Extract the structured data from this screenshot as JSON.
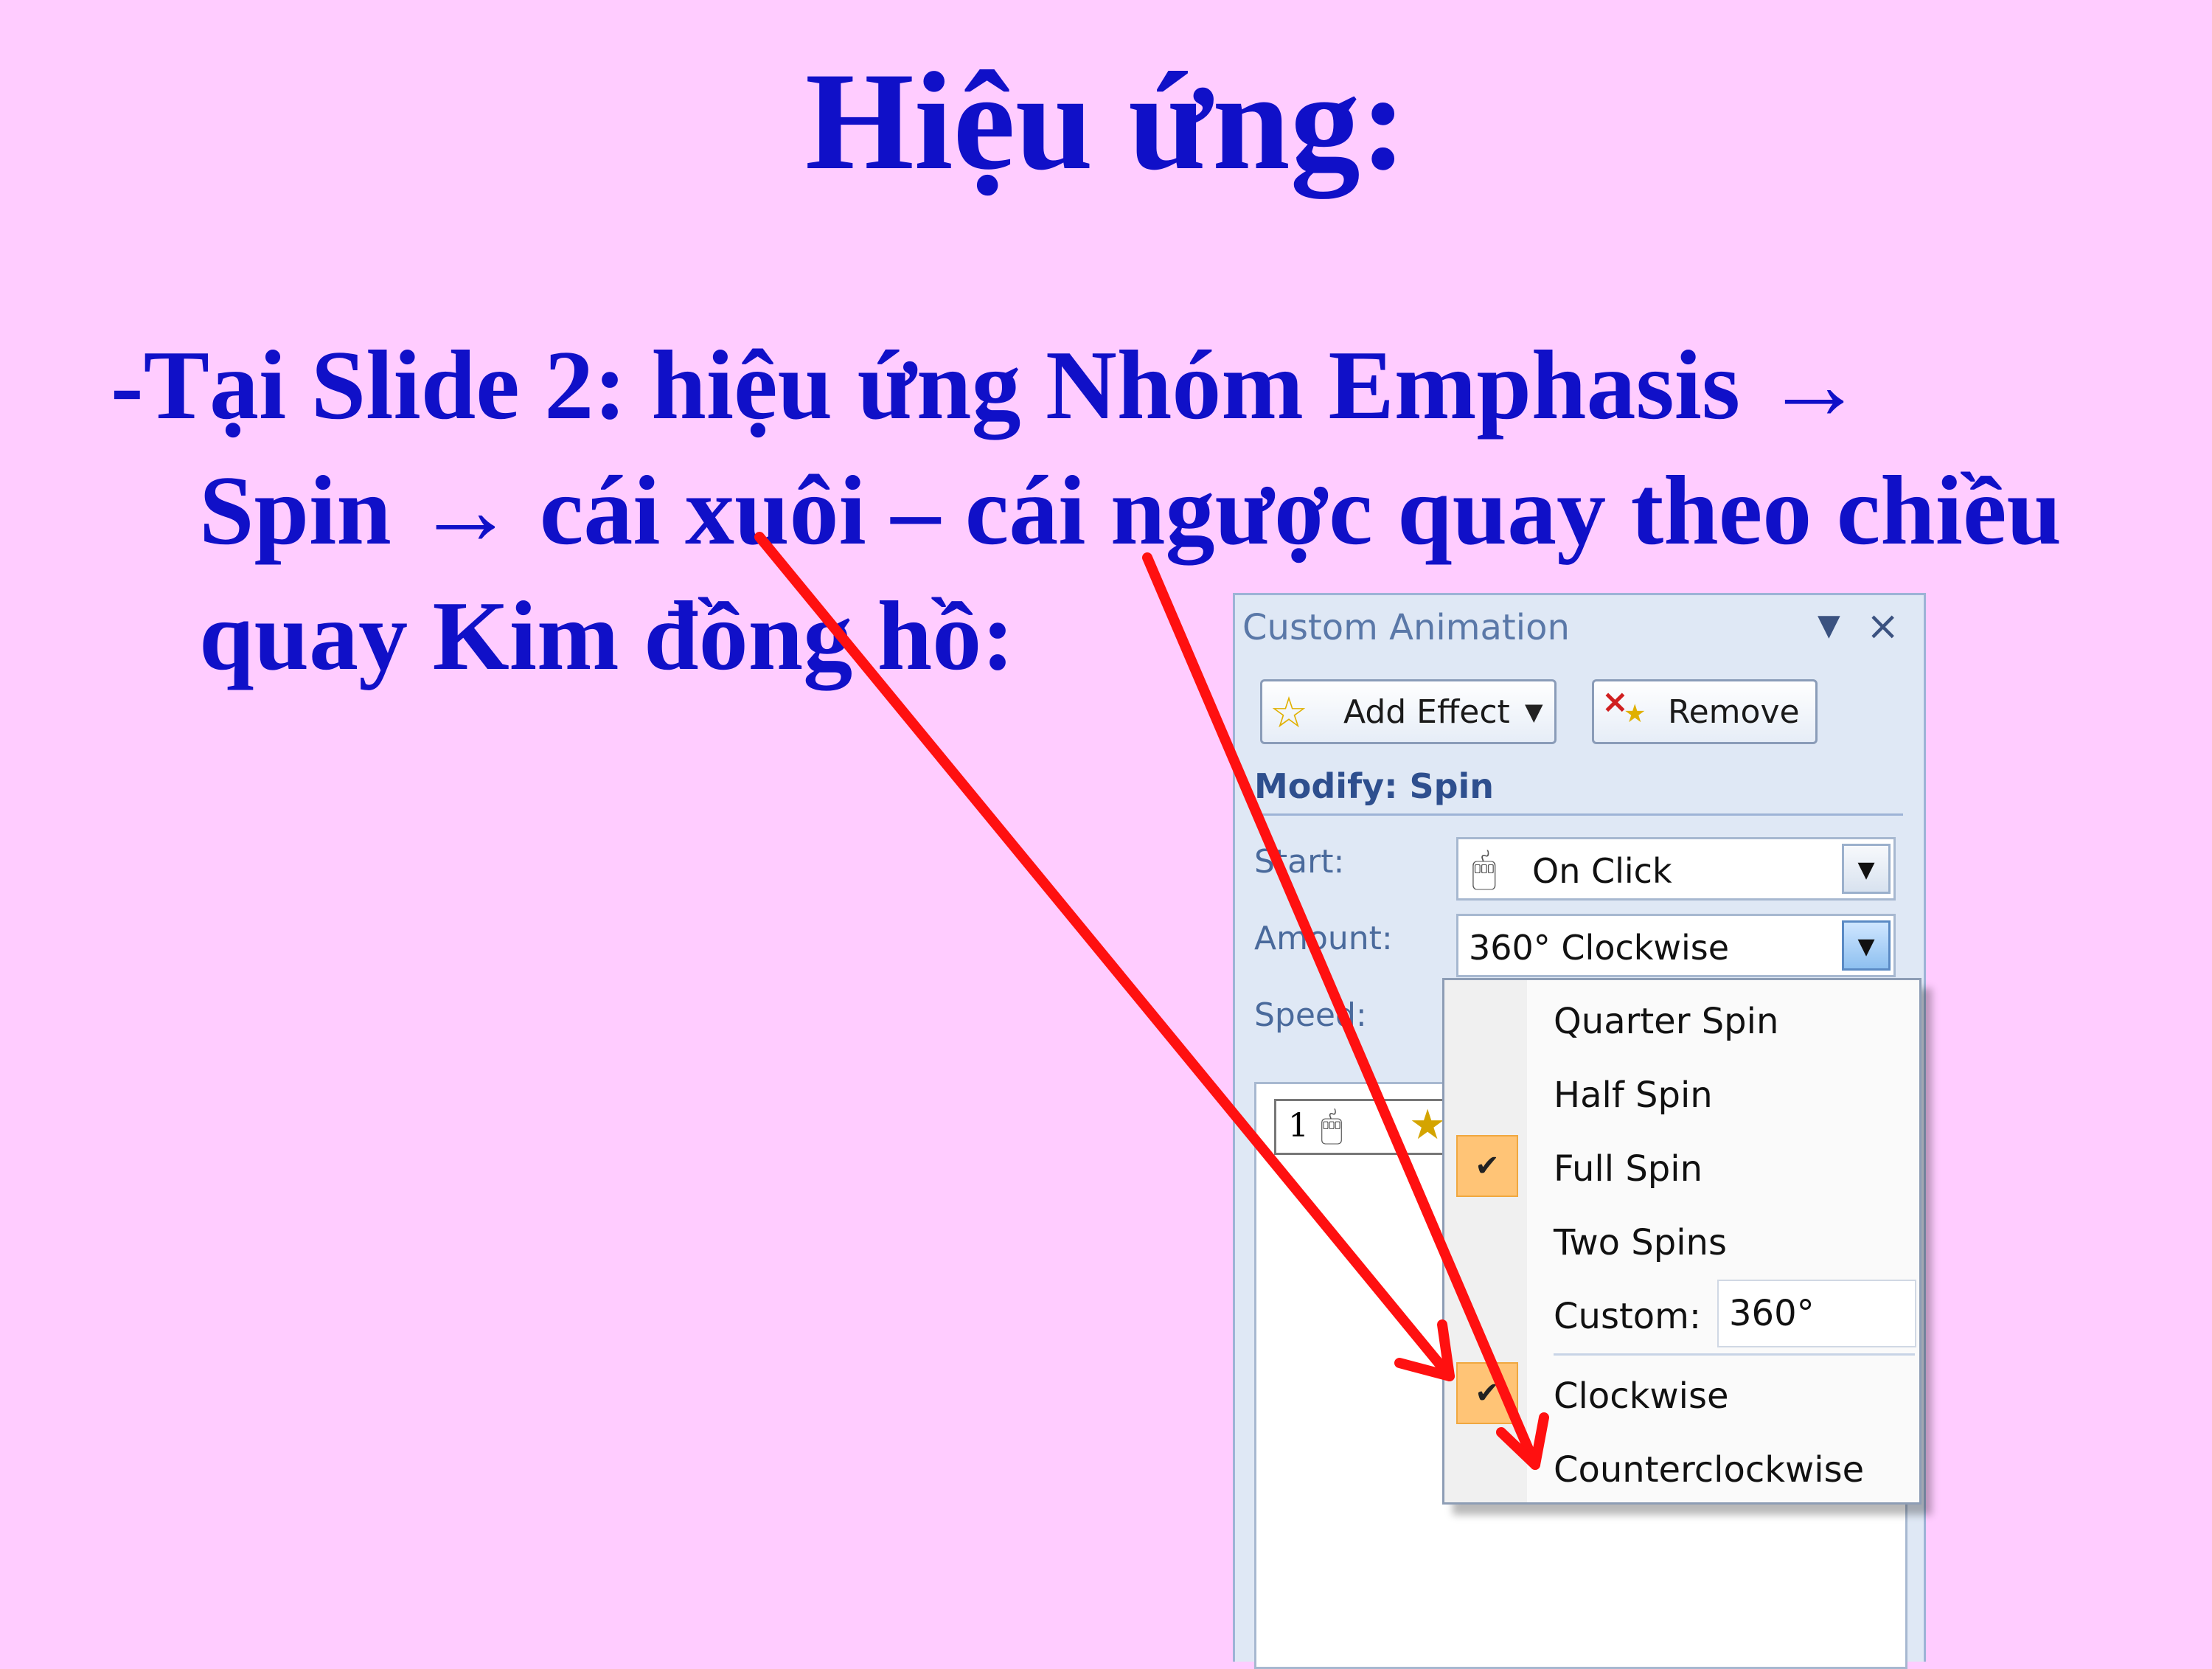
{
  "slide": {
    "title": "Hiệu ứng:",
    "bullet_lines": [
      "-Tại Slide 2: hiệu ứng Nhóm Emphasis →",
      "Spin → cái xuôi – cái ngược quay theo chiều",
      "quay Kim đồng hồ:"
    ]
  },
  "pane": {
    "title": "Custom Animation",
    "add_effect_label": "Add Effect",
    "remove_label": "Remove",
    "modify_heading": "Modify: Spin",
    "start_label": "Start:",
    "start_value": "On Click",
    "amount_label": "Amount:",
    "amount_value": "360° Clockwise",
    "speed_label": "Speed:",
    "list_item_number": "1"
  },
  "menu": {
    "items": [
      {
        "label": "Quarter Spin",
        "checked": false
      },
      {
        "label": "Half Spin",
        "checked": false
      },
      {
        "label": "Full Spin",
        "checked": true
      },
      {
        "label": "Two Spins",
        "checked": false
      }
    ],
    "custom_label": "Custom:",
    "custom_value": "360°",
    "direction_items": [
      {
        "label": "Clockwise",
        "checked": true
      },
      {
        "label": "Counterclockwise",
        "checked": false
      }
    ]
  },
  "colors": {
    "background": "#ffccff",
    "text": "#1010c8",
    "arrow": "#ff0000",
    "check_highlight": "#ffc476"
  }
}
